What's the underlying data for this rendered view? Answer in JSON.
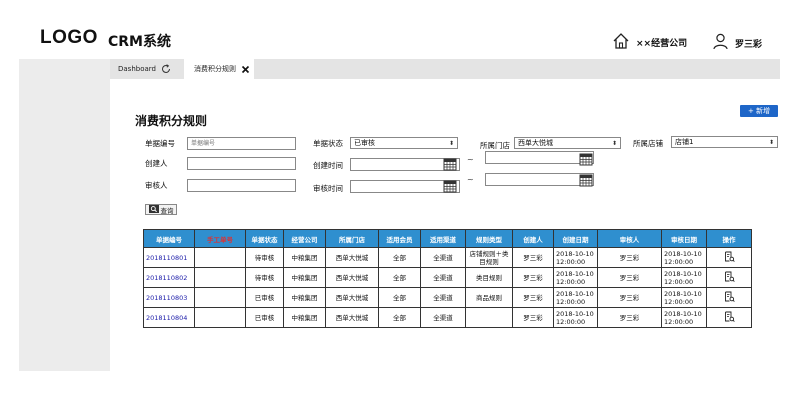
{
  "header": {
    "logo": "LOGO",
    "app_title": "CRM系统",
    "company": "××经营公司",
    "user": "罗三彩"
  },
  "tabs": [
    {
      "label": "Dashboard"
    },
    {
      "label": "消费积分规则"
    }
  ],
  "page": {
    "title": "消费积分规则",
    "add_label": "+ 新增"
  },
  "filters": {
    "doc_no_label": "单据编号",
    "doc_no_placeholder": "单据编号",
    "status_label": "单据状态",
    "status_value": "已审核",
    "store_label": "所属门店",
    "store_value": "西单大悦城",
    "shop_label": "所属店铺",
    "shop_value": "店铺1",
    "creator_label": "创建人",
    "create_time_label": "创建时间",
    "reviewer_label": "审核人",
    "review_time_label": "审核时间",
    "tilde": "~",
    "query_label": "查询"
  },
  "table": {
    "columns": [
      "单据编号",
      "手工单号",
      "单据状态",
      "经营公司",
      "所属门店",
      "适用会员",
      "适用渠道",
      "规则类型",
      "创建人",
      "创建日期",
      "审核人",
      "审核日期",
      "操作"
    ],
    "rows": [
      [
        "2018110801",
        "",
        "待审核",
        "中粮集团",
        "西单大悦城",
        "全部",
        "全渠道",
        "店铺规则＋类目规则",
        "罗三彩",
        "2018-10-10 12:00:00",
        "罗三彩",
        "2018-10-10 12:00:00"
      ],
      [
        "2018110802",
        "",
        "待审核",
        "中粮集团",
        "西单大悦城",
        "全部",
        "全渠道",
        "类目规则",
        "罗三彩",
        "2018-10-10 12:00:00",
        "罗三彩",
        "2018-10-10 12:00:00"
      ],
      [
        "2018110803",
        "",
        "已审核",
        "中粮集团",
        "西单大悦城",
        "全部",
        "全渠道",
        "商品规则",
        "罗三彩",
        "2018-10-10 12:00:00",
        "罗三彩",
        "2018-10-10 12:00:00"
      ],
      [
        "2018110804",
        "",
        "已审核",
        "中粮集团",
        "西单大悦城",
        "全部",
        "全渠道",
        "",
        "罗三彩",
        "2018-10-10 12:00:00",
        "罗三彩",
        "2018-10-10 12:00:00"
      ]
    ],
    "action_icon": "document-edit-icon"
  }
}
